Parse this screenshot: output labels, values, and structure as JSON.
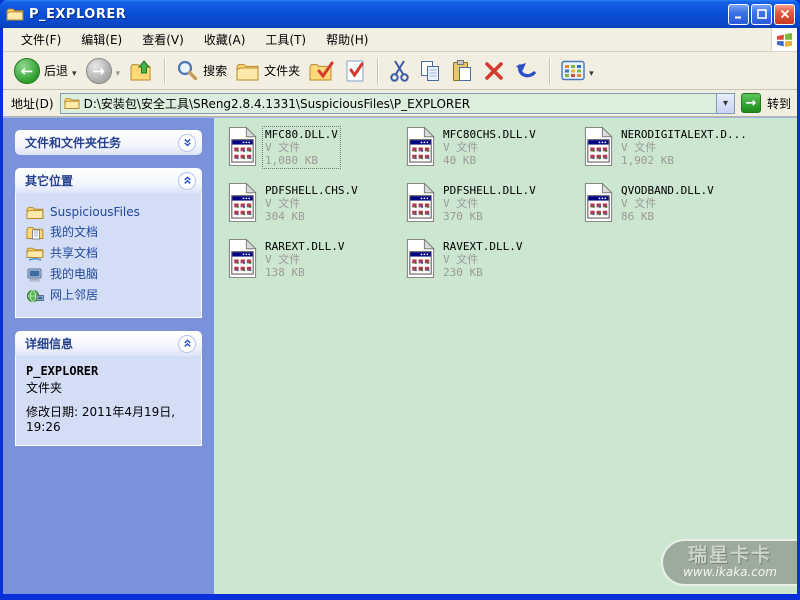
{
  "colors": {
    "titlebar_blue": "#0B51D8",
    "window_border": "#0831D9",
    "sidebar_blue": "#7A92DC",
    "panel_body": "#D3DDF6",
    "panel_title_blue": "#26418F",
    "file_area_green": "#CDE6CF",
    "toolbar_tan": "#F2EFE2",
    "go_button_green": "#2EA42E",
    "secondary_text_gray": "#9A9A9A"
  },
  "window": {
    "title": "P_EXPLORER"
  },
  "menu": {
    "items": [
      {
        "label": "文件(F)"
      },
      {
        "label": "编辑(E)"
      },
      {
        "label": "查看(V)"
      },
      {
        "label": "收藏(A)"
      },
      {
        "label": "工具(T)"
      },
      {
        "label": "帮助(H)"
      }
    ]
  },
  "toolbar": {
    "back_label": "后退",
    "search_label": "搜索",
    "folders_label": "文件夹"
  },
  "address_bar": {
    "label": "地址(D)",
    "path": "D:\\安装包\\安全工具\\SReng2.8.4.1331\\SuspiciousFiles\\P_EXPLORER",
    "go_label": "转到"
  },
  "sidebar": {
    "panels": [
      {
        "title": "文件和文件夹任务",
        "collapsed": true
      },
      {
        "title": "其它位置",
        "items": [
          {
            "label": "SuspiciousFiles",
            "icon": "folder-icon"
          },
          {
            "label": "我的文档",
            "icon": "my-documents-icon"
          },
          {
            "label": "共享文档",
            "icon": "shared-documents-icon"
          },
          {
            "label": "我的电脑",
            "icon": "my-computer-icon"
          },
          {
            "label": "网上邻居",
            "icon": "network-places-icon"
          }
        ]
      },
      {
        "title": "详细信息",
        "details": {
          "name": "P_EXPLORER",
          "type": "文件夹",
          "modified": "修改日期: 2011年4月19日,",
          "modified_time": "19:26"
        }
      }
    ]
  },
  "files": [
    {
      "name": "MFC80.DLL.V",
      "type": "V 文件",
      "size": "1,080 KB",
      "selected": true
    },
    {
      "name": "MFC80CHS.DLL.V",
      "type": "V 文件",
      "size": "40 KB",
      "selected": false
    },
    {
      "name": "NERODIGITALEXT.D...",
      "type": "V 文件",
      "size": "1,902 KB",
      "selected": false
    },
    {
      "name": "PDFSHELL.CHS.V",
      "type": "V 文件",
      "size": "304 KB",
      "selected": false
    },
    {
      "name": "PDFSHELL.DLL.V",
      "type": "V 文件",
      "size": "370 KB",
      "selected": false
    },
    {
      "name": "QVODBAND.DLL.V",
      "type": "V 文件",
      "size": "86 KB",
      "selected": false
    },
    {
      "name": "RAREXT.DLL.V",
      "type": "V 文件",
      "size": "138 KB",
      "selected": false
    },
    {
      "name": "RAVEXT.DLL.V",
      "type": "V 文件",
      "size": "230 KB",
      "selected": false
    }
  ],
  "watermark": {
    "line1": "瑞星卡卡",
    "line2": "www.ikaka.com"
  }
}
